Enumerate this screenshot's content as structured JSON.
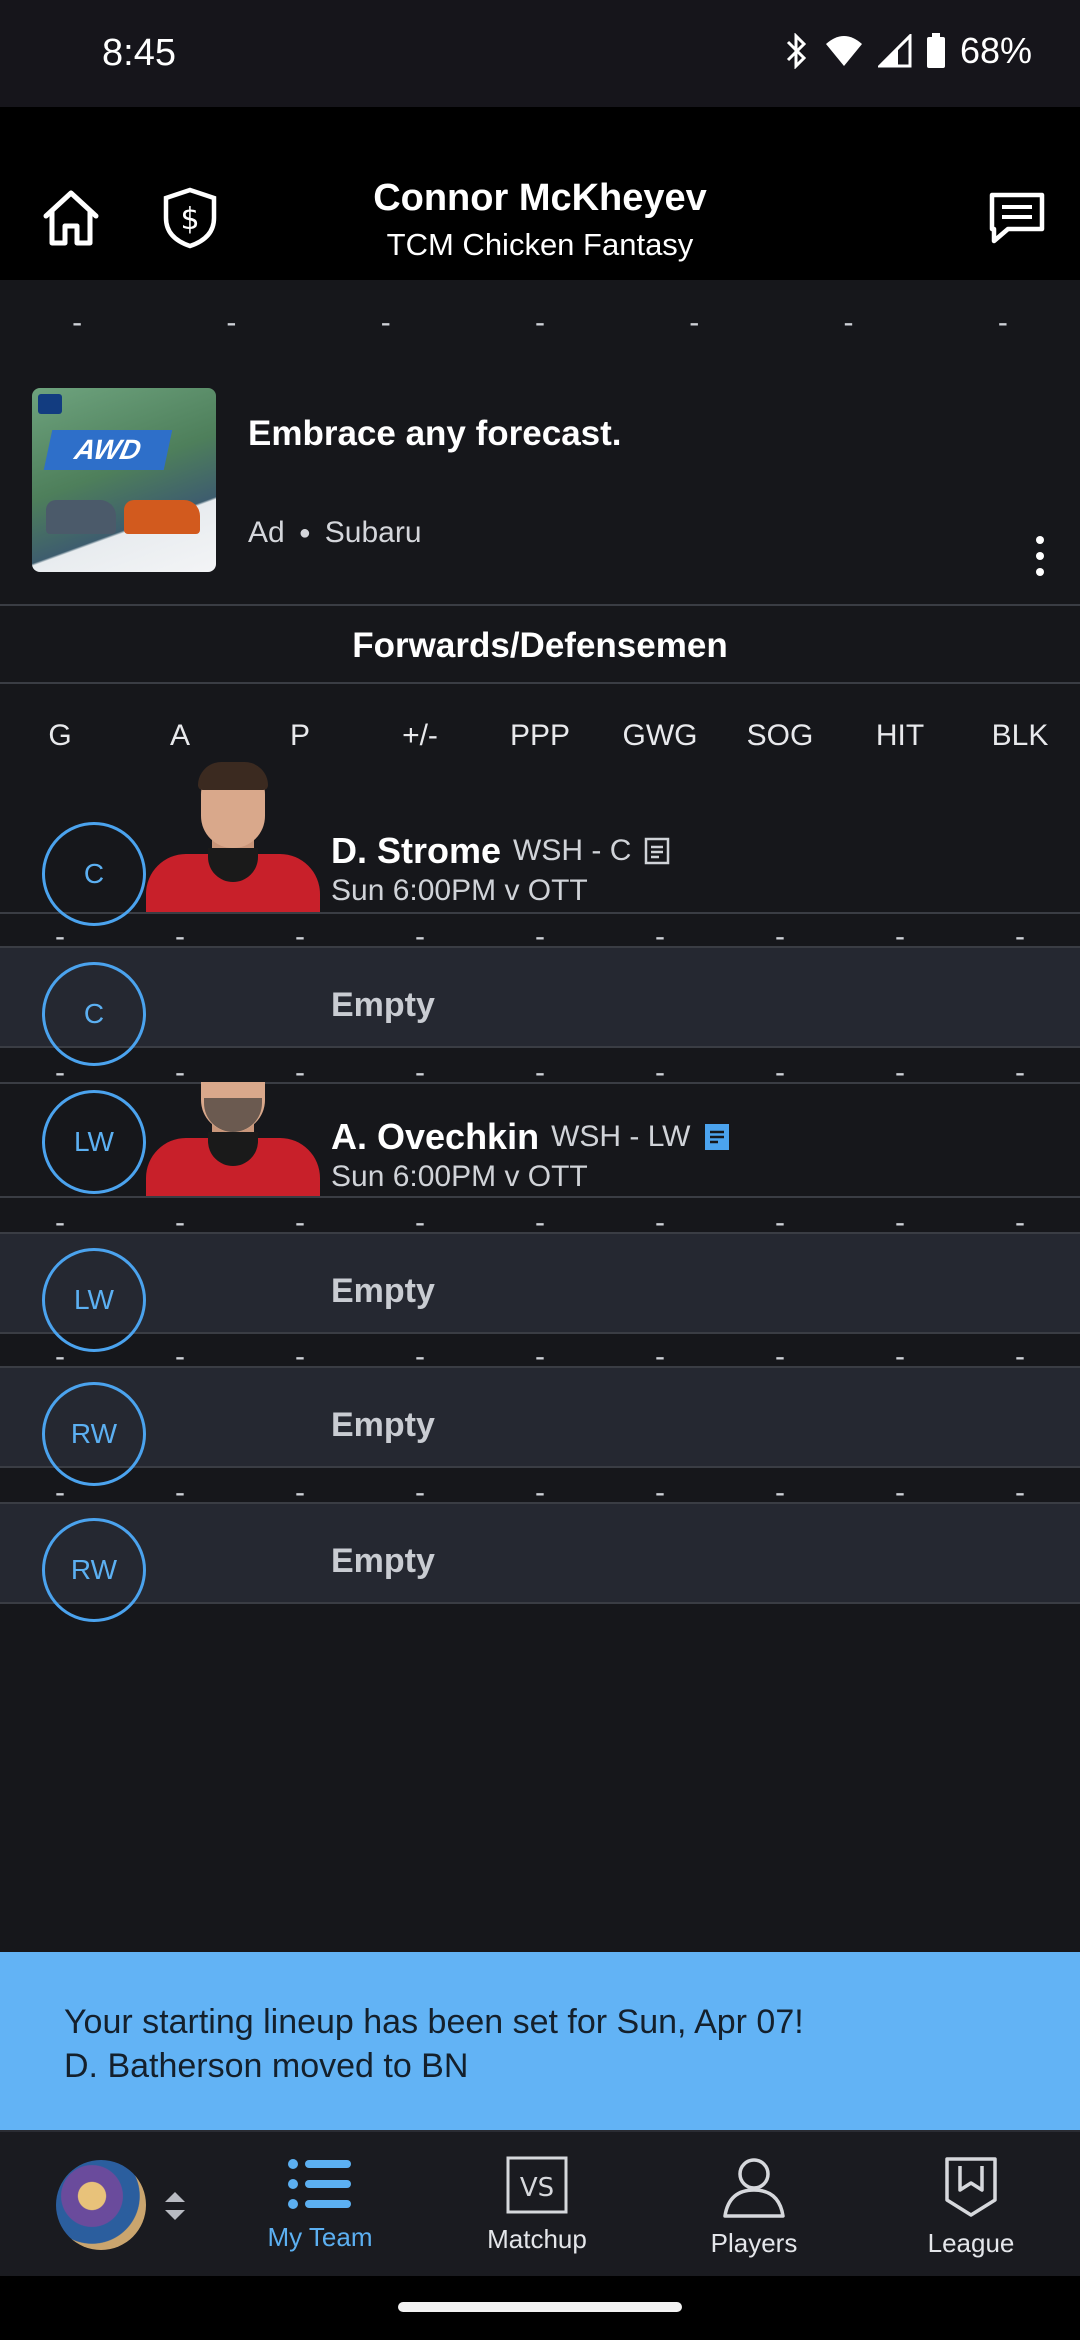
{
  "status_bar": {
    "time": "8:45",
    "battery": "68%"
  },
  "header": {
    "title": "Connor McKheyev",
    "subtitle": "TCM Chicken Fantasy"
  },
  "ad": {
    "headline": "Embrace any forecast.",
    "label": "Ad",
    "advertiser": "Subaru",
    "image_text": "AWD"
  },
  "section": {
    "title": "Forwards/Defensemen"
  },
  "columns": [
    "G",
    "A",
    "P",
    "+/-",
    "PPP",
    "GWG",
    "SOG",
    "HIT",
    "BLK"
  ],
  "top_dashes": [
    "-",
    "-",
    "-",
    "-",
    "-",
    "-",
    "-"
  ],
  "stat_dashes": [
    "-",
    "-",
    "-",
    "-",
    "-",
    "-",
    "-",
    "-",
    "-"
  ],
  "roster": [
    {
      "pos": "C",
      "name": "D. Strome",
      "team": "WSH - C",
      "game": "Sun 6:00PM v OTT",
      "has_note": true,
      "note_highlight": false
    },
    {
      "pos": "C",
      "empty_label": "Empty"
    },
    {
      "pos": "LW",
      "name": "A. Ovechkin",
      "team": "WSH - LW",
      "game": "Sun 6:00PM v OTT",
      "has_note": true,
      "note_highlight": true
    },
    {
      "pos": "LW",
      "empty_label": "Empty"
    },
    {
      "pos": "RW",
      "empty_label": "Empty"
    },
    {
      "pos": "RW",
      "empty_label": "Empty"
    }
  ],
  "toast": {
    "line1": "Your starting lineup has been set for Sun, Apr 07!",
    "line2": "D. Batherson moved to BN"
  },
  "tabs": [
    {
      "label": "My Team",
      "icon": "list-icon",
      "active": true
    },
    {
      "label": "Matchup",
      "icon": "vs-icon",
      "active": false
    },
    {
      "label": "Players",
      "icon": "person-icon",
      "active": false
    },
    {
      "label": "League",
      "icon": "shield-bookmark-icon",
      "active": false
    }
  ],
  "colors": {
    "accent": "#5cb0f2",
    "toast_bg": "#62b3f5",
    "empty_row_bg": "#252831",
    "jersey": "#c8202a"
  }
}
